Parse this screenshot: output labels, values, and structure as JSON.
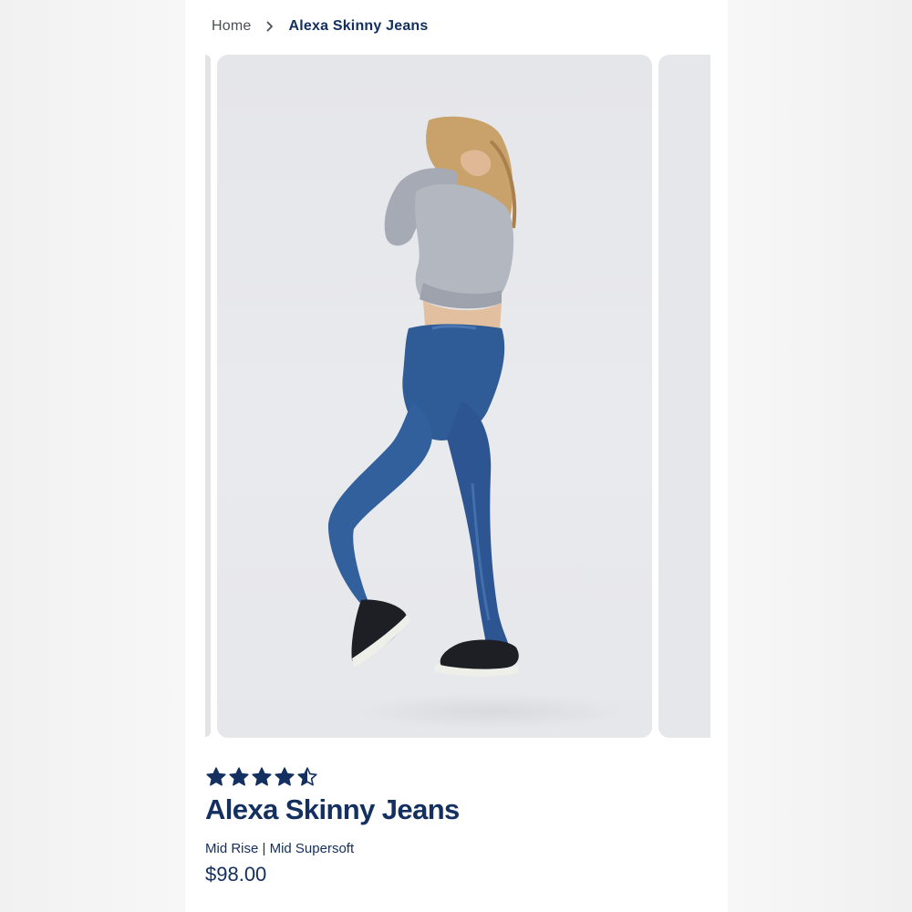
{
  "breadcrumb": {
    "home": "Home",
    "current": "Alexa Skinny Jeans"
  },
  "carousel": {
    "main_image": "product-photo: model wearing dark blue skinny jeans, grey sweatshirt and black sneakers"
  },
  "product": {
    "rating": 4.5,
    "rating_max": 5,
    "name": "Alexa Skinny Jeans",
    "subtitle": "Mid Rise | Mid Supersoft",
    "price": "$98.00"
  },
  "colors": {
    "brand": "#143060",
    "muted_text": "#4a4f57",
    "image_bg": "#e7e8ec"
  },
  "icons": {
    "breadcrumb_separator": "chevron-right-icon",
    "rating": "star-icon"
  }
}
